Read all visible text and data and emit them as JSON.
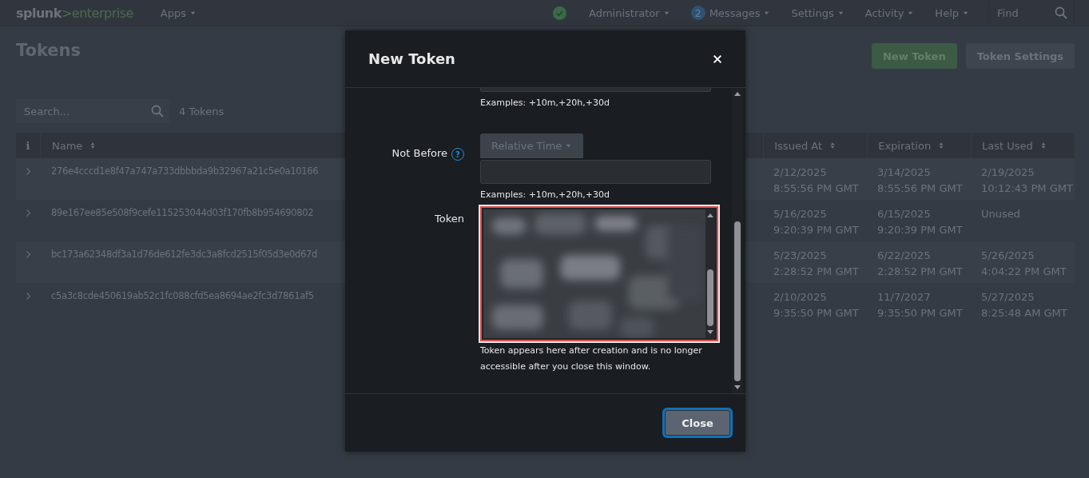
{
  "navbar": {
    "logo": [
      "splunk",
      ">enterprise"
    ],
    "apps": "Apps",
    "status_ok": true,
    "user": "Administrator",
    "messages_count": "2",
    "messages": "Messages",
    "menus": [
      "Settings",
      "Activity",
      "Help"
    ],
    "find": {
      "placeholder": "Find"
    }
  },
  "page": {
    "title": "Tokens",
    "buttons": [
      {
        "label": "New Token",
        "kind": "primary"
      },
      {
        "label": "Token Settings",
        "kind": "secondary"
      }
    ],
    "search": {
      "placeholder": "Search..."
    },
    "count": "4 Tokens"
  },
  "table": {
    "columns": [
      {
        "label": "i",
        "kind": "info"
      },
      {
        "label": "Name",
        "kind": "sort"
      },
      {
        "label": "Issued At",
        "kind": "sort"
      },
      {
        "label": "Expiration",
        "kind": "sort"
      },
      {
        "label": "Last Used",
        "kind": "sort"
      }
    ],
    "rows": [
      {
        "name": "276e4cccd1e8f47a747a733dbbbda9b32967a21c5e0a10166",
        "issued_at": [
          "2/12/2025",
          "8:55:56 PM GMT"
        ],
        "expiration": [
          "3/14/2025",
          "8:55:56 PM GMT"
        ],
        "last_used": [
          "2/19/2025",
          "10:12:43 PM GMT"
        ]
      },
      {
        "name": "89e167ee85e508f9cefe115253044d03f170fb8b954690802",
        "issued_at": [
          "5/16/2025",
          "9:20:39 PM GMT"
        ],
        "expiration": [
          "6/15/2025",
          "9:20:39 PM GMT"
        ],
        "last_used": [
          "Unused"
        ]
      },
      {
        "name": "bc173a62348df3a1d76de612fe3dc3a8fcd2515f05d3e0d67d",
        "issued_at": [
          "5/23/2025",
          "2:28:52 PM GMT"
        ],
        "expiration": [
          "6/22/2025",
          "2:28:52 PM GMT"
        ],
        "last_used": [
          "5/26/2025",
          "4:04:22 PM GMT"
        ]
      },
      {
        "name": "c5a3c8cde450619ab52c1fc088cfd5ea8694ae2fc3d7861af5",
        "issued_at": [
          "2/10/2025",
          "9:35:50 PM GMT"
        ],
        "expiration": [
          "11/7/2027",
          "9:35:50 PM GMT"
        ],
        "last_used": [
          "5/27/2025",
          "8:25:48 AM GMT"
        ]
      }
    ]
  },
  "modal": {
    "title": "New Token",
    "sections": [
      {
        "kind": "cut_input",
        "hint": "Examples: +10m,+20h,+30d"
      },
      {
        "kind": "time",
        "label": "Not Before",
        "help": "?",
        "dropdown": {
          "label": "Relative Time",
          "disabled": true
        },
        "hint": "Examples: +10m,+20h,+30d"
      },
      {
        "kind": "token",
        "label": "Token",
        "highlighted": true,
        "hint": "Token appears here after creation and is no longer accessible after you close this window."
      }
    ],
    "footer_button": {
      "label": "Close",
      "focused": true
    }
  }
}
